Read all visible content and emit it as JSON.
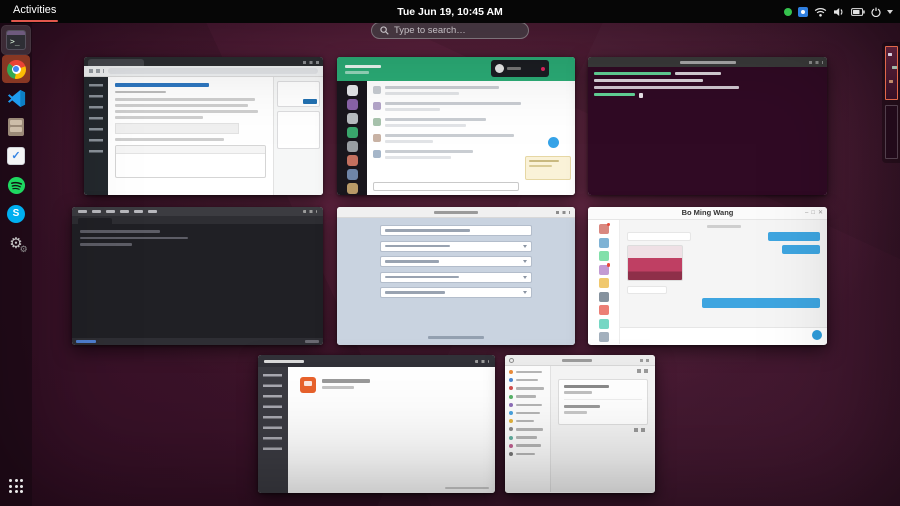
{
  "top_bar": {
    "activities_label": "Activities",
    "clock": "Tue Jun 19, 10:45 AM",
    "status_icons": [
      "recording-dot-icon",
      "input-method-icon",
      "wifi-icon",
      "volume-icon",
      "battery-icon",
      "power-icon"
    ]
  },
  "search": {
    "placeholder": "Type to search…"
  },
  "dock": {
    "apps": [
      "terminal",
      "chrome",
      "vscode",
      "files",
      "todo",
      "spotify",
      "skype",
      "system-settings"
    ],
    "focused_app": "chrome",
    "show_apps": "show-applications"
  },
  "workspaces": {
    "count": 2,
    "active_index": 0
  },
  "windows": [
    {
      "id": "browser-editor",
      "row": 1
    },
    {
      "id": "slack-call",
      "row": 1
    },
    {
      "id": "terminal",
      "row": 1
    },
    {
      "id": "code-editor",
      "row": 2
    },
    {
      "id": "form-dialog",
      "row": 2
    },
    {
      "id": "chat",
      "row": 2,
      "title": "Bo Ming Wang"
    },
    {
      "id": "dark-sidebar-app",
      "row": 3
    },
    {
      "id": "gnome-settings",
      "row": 3
    }
  ],
  "colors": {
    "accent_orange": "#E95420",
    "panel_black": "#060606",
    "slack_green": "#2BAC76",
    "terminal_purple": "#300A24",
    "chat_blue": "#3EA5E0"
  }
}
